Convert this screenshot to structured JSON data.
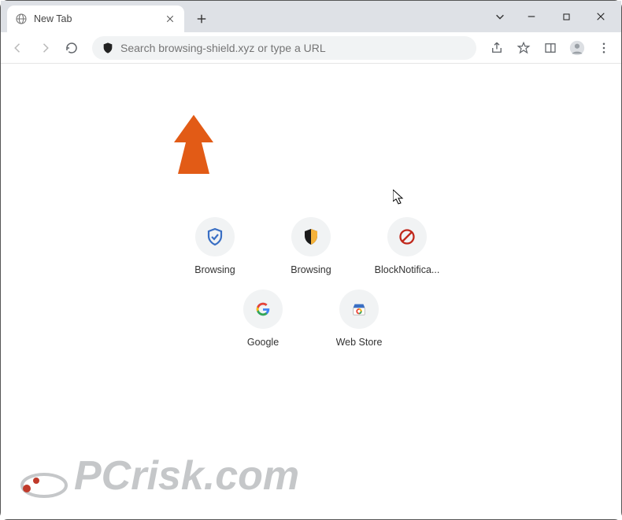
{
  "tab": {
    "title": "New Tab"
  },
  "omnibox": {
    "placeholder": "Search browsing-shield.xyz or type a URL"
  },
  "shortcuts": [
    {
      "label": "Browsing",
      "icon": "shield-blue"
    },
    {
      "label": "Browsing",
      "icon": "shield-dark"
    },
    {
      "label": "BlockNotifica...",
      "icon": "block-red"
    },
    {
      "label": "Google",
      "icon": "google"
    },
    {
      "label": "Web Store",
      "icon": "webstore"
    }
  ],
  "watermark": "PCrisk.com"
}
